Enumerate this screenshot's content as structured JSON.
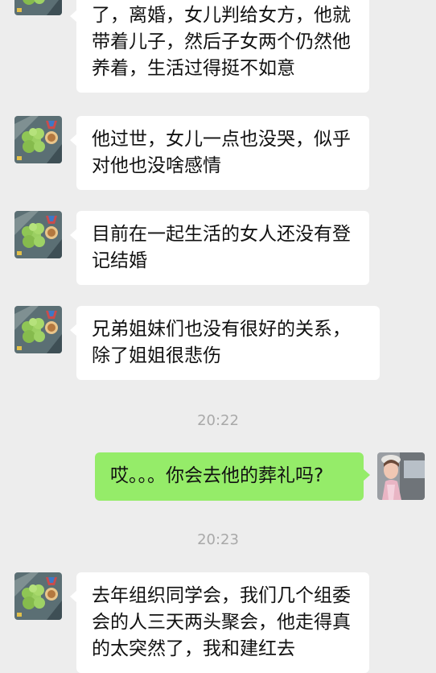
{
  "colors": {
    "background": "#ededed",
    "incoming_bubble": "#ffffff",
    "outgoing_bubble": "#95ec69",
    "timestamp_text": "#a9a9a9"
  },
  "messages": [
    {
      "text": "了，离婚，女儿判给女方，他就带着儿子，然后子女两个仍然他养着，生活过得挺不如意"
    },
    {
      "text": "他过世，女儿一点也没哭，似乎对他也没啥感情"
    },
    {
      "text": "目前在一起生活的女人还没有登记结婚"
    },
    {
      "text": "兄弟姐妹们也没有很好的关系，除了姐姐很悲伤"
    },
    {
      "time": "20:22"
    },
    {
      "text": "哎。。。你会去他的葬礼吗?"
    },
    {
      "time": "20:23"
    },
    {
      "text": "去年组织同学会，我们几个组委会的人三天两头聚会，他走得真的太突然了，我和建红去"
    }
  ]
}
